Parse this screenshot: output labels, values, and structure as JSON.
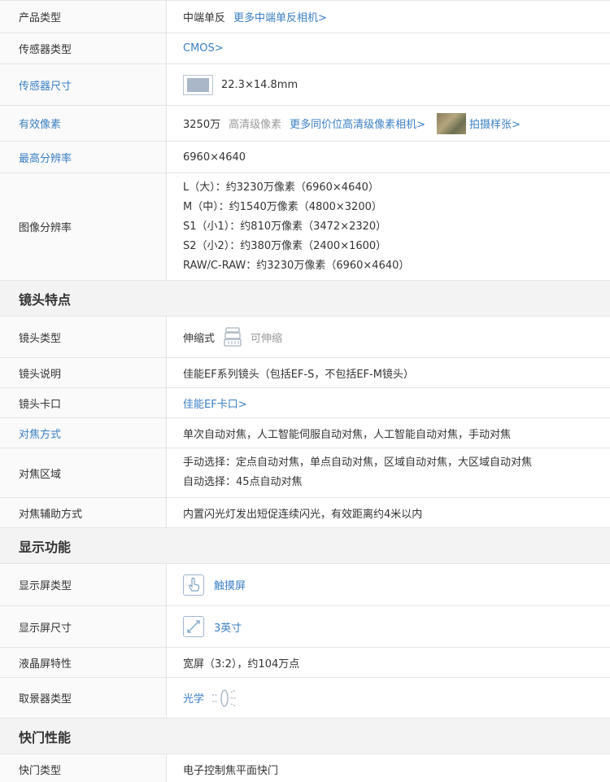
{
  "rows_a": {
    "product_type": {
      "label": "产品类型",
      "value": "中端单反",
      "link": "更多中端单反相机>"
    },
    "sensor_type": {
      "label": "传感器类型",
      "value": "CMOS>"
    },
    "sensor_size": {
      "label": "传感器尺寸",
      "value": "22.3×14.8mm"
    },
    "effective_pixels": {
      "label": "有效像素",
      "value": "3250万",
      "tag": "高清级像素",
      "link": "更多同价位高清级像素相机>",
      "sample": "拍摄样张>"
    },
    "max_resolution": {
      "label": "最高分辨率",
      "value": "6960×4640"
    },
    "image_resolution": {
      "label": "图像分辨率",
      "lines": [
        "L（大）：约3230万像素（6960×4640）",
        "M（中）：约1540万像素（4800×3200）",
        "S1（小1）：约810万像素（3472×2320）",
        "S2（小2）：约380万像素（2400×1600）",
        "RAW/C-RAW：约3230万像素（6960×4640）"
      ]
    }
  },
  "section_lens": {
    "title": "镜头特点"
  },
  "rows_b": {
    "lens_type": {
      "label": "镜头类型",
      "value": "伸缩式",
      "icon_label": "可伸缩"
    },
    "lens_desc": {
      "label": "镜头说明",
      "value": "佳能EF系列镜头（包括EF-S，不包括EF-M镜头）"
    },
    "lens_mount": {
      "label": "镜头卡口",
      "value": "佳能EF卡口>"
    },
    "focus_mode": {
      "label": "对焦方式",
      "value": "单次自动对焦，人工智能伺服自动对焦，人工智能自动对焦，手动对焦"
    },
    "focus_area": {
      "label": "对焦区域",
      "lines": [
        "手动选择：定点自动对焦，单点自动对焦，区域自动对焦，大区域自动对焦",
        "自动选择：45点自动对焦"
      ]
    },
    "focus_assist": {
      "label": "对焦辅助方式",
      "value": "内置闪光灯发出短促连续闪光，有效距离约4米以内"
    }
  },
  "section_display": {
    "title": "显示功能"
  },
  "rows_c": {
    "screen_type": {
      "label": "显示屏类型",
      "value": "触摸屏"
    },
    "screen_size": {
      "label": "显示屏尺寸",
      "value": "3英寸"
    },
    "lcd_features": {
      "label": "液晶屏特性",
      "value": "宽屏（3:2），约104万点"
    },
    "viewfinder": {
      "label": "取景器类型",
      "value": "光学"
    }
  },
  "section_shutter": {
    "title": "快门性能"
  },
  "rows_d": {
    "shutter_type": {
      "label": "快门类型",
      "value": "电子控制焦平面快门"
    }
  },
  "colors": {
    "link": "#3b7fc4",
    "border": "#e5e5e5",
    "section_bg": "#f3f3f3"
  }
}
